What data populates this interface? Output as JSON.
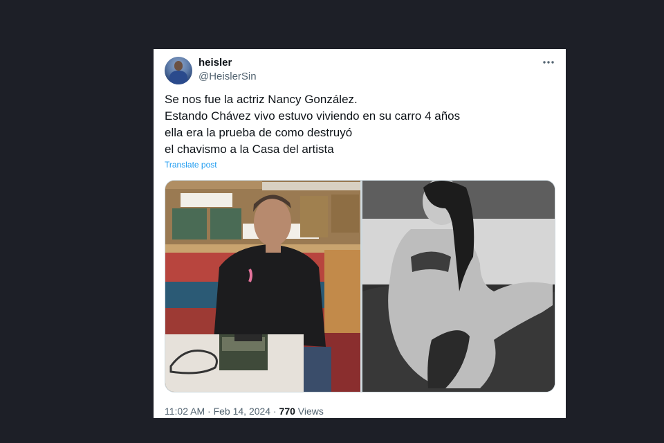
{
  "tweet": {
    "author": {
      "display_name": "heisler",
      "handle": "@HeislerSin",
      "avatar_icon": "profile-avatar"
    },
    "more_icon": "more-horizontal-icon",
    "text_lines": [
      "Se nos fue la actriz Nancy González.",
      "Estando Chávez vivo estuvo viviendo en su carro 4 años",
      "ella era la prueba de como destruyó",
      "el chavismo a la Casa del artista"
    ],
    "translate_label": "Translate post",
    "media": [
      {
        "kind": "photo",
        "description_icon": "color-photo"
      },
      {
        "kind": "photo",
        "description_icon": "bw-photo"
      }
    ],
    "time": "11:02 AM",
    "separator": "·",
    "date": "Feb 14, 2024",
    "views_count": "770",
    "views_label": "Views"
  },
  "colors": {
    "background": "#1d1f27",
    "card": "#ffffff",
    "text_primary": "#0f1419",
    "text_secondary": "#536471",
    "link": "#1d9bf0"
  }
}
